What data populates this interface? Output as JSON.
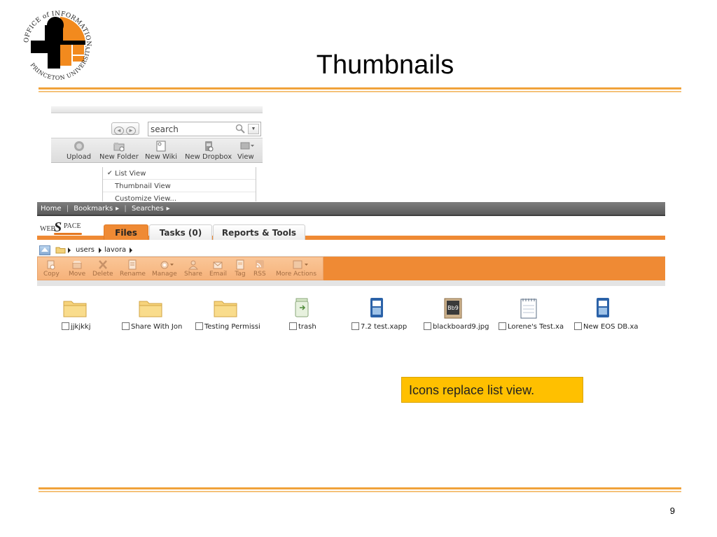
{
  "slide": {
    "title": "Thumbnails",
    "page_number": "9",
    "accent_color": "#f0a23a",
    "logo": {
      "ring_text": "OFFICE of INFORMATION TECHNOLOGY",
      "bottom_text": "PRINCETON UNIVERSITY",
      "colors": {
        "orange": "#f28a1e",
        "black": "#000000"
      }
    }
  },
  "toolbar_shot": {
    "search": {
      "placeholder": "search",
      "icon": "magnifier-icon",
      "dropdown_icon": "chevron-down-icon"
    },
    "buttons": [
      {
        "label": "Upload",
        "icon": "upload-icon"
      },
      {
        "label": "New Folder",
        "icon": "new-folder-icon"
      },
      {
        "label": "New Wiki",
        "icon": "new-wiki-icon"
      },
      {
        "label": "New Dropbox",
        "icon": "new-dropbox-icon"
      },
      {
        "label": "View",
        "icon": "view-icon"
      }
    ],
    "view_menu": [
      {
        "label": "List View",
        "checked": true
      },
      {
        "label": "Thumbnail View",
        "checked": false
      },
      {
        "label": "Customize View..."
      }
    ]
  },
  "webspace": {
    "nav": {
      "home": "Home",
      "bookmarks": "Bookmarks",
      "searches": "Searches",
      "separator": "|"
    },
    "brand": {
      "web": "WEB",
      "s": "S",
      "pace": "PACE"
    },
    "tabs": [
      {
        "label": "Files",
        "active": true
      },
      {
        "label": "Tasks (0)",
        "active": false
      },
      {
        "label": "Reports & Tools",
        "active": false
      }
    ],
    "breadcrumb": [
      "users",
      "lavora"
    ],
    "actions": [
      {
        "label": "Copy",
        "icon": "copy-icon"
      },
      {
        "label": "Move",
        "icon": "move-icon"
      },
      {
        "label": "Delete",
        "icon": "delete-icon"
      },
      {
        "label": "Rename",
        "icon": "rename-icon"
      },
      {
        "label": "Manage",
        "icon": "manage-icon"
      },
      {
        "label": "Share",
        "icon": "share-icon"
      },
      {
        "label": "Email",
        "icon": "email-icon"
      },
      {
        "label": "Tag",
        "icon": "tag-icon"
      },
      {
        "label": "RSS",
        "icon": "rss-icon"
      },
      {
        "label": "More Actions",
        "icon": "more-actions-icon"
      }
    ],
    "files": [
      {
        "name": "jjkjkkj",
        "type": "folder"
      },
      {
        "name": "Share With Jon",
        "type": "folder"
      },
      {
        "name": "Testing Permissi",
        "type": "folder"
      },
      {
        "name": "trash",
        "type": "trash"
      },
      {
        "name": "7.2 test.xapp",
        "type": "xapp"
      },
      {
        "name": "blackboard9.jpg",
        "type": "image"
      },
      {
        "name": "Lorene's Test.xa",
        "type": "notepad"
      },
      {
        "name": "New EOS DB.xa",
        "type": "xapp"
      }
    ],
    "colors": {
      "orange": "#ef8a34",
      "nav_gray": "#5a5a5a"
    }
  },
  "callout": {
    "text": "Icons replace list view.",
    "color": "#ffc000"
  }
}
